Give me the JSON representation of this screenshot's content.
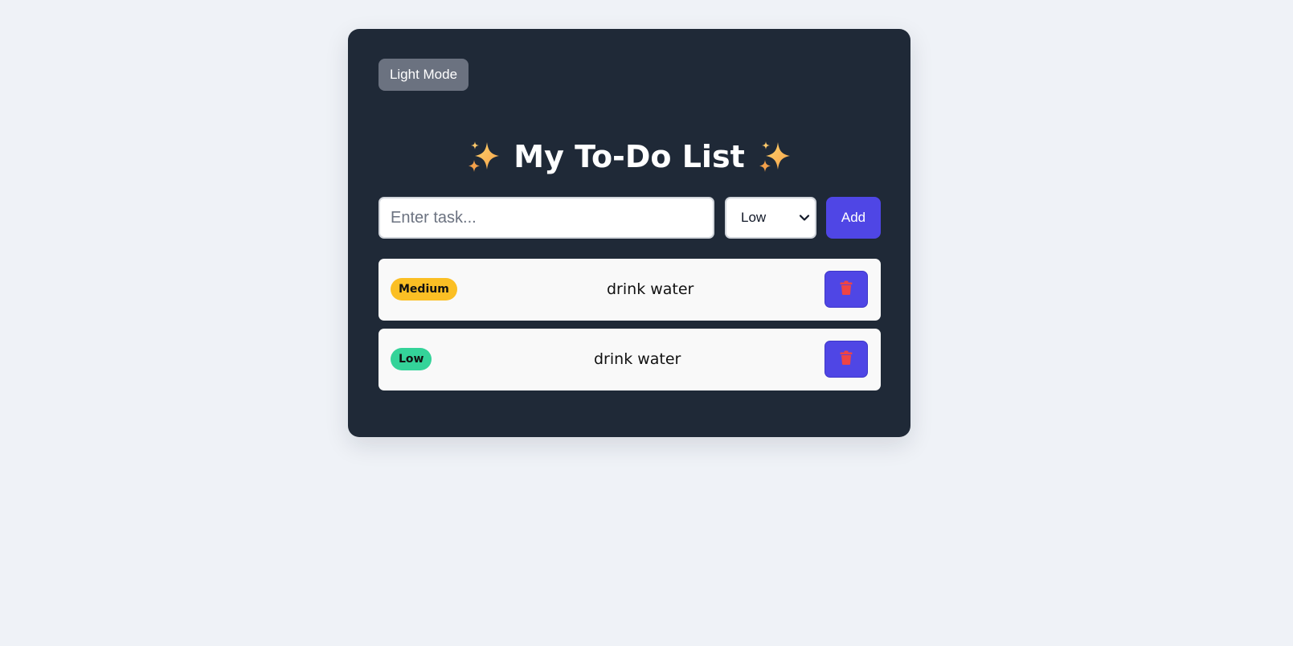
{
  "header": {
    "mode_toggle_label": "Light Mode",
    "title": "My To-Do List"
  },
  "form": {
    "task_placeholder": "Enter task...",
    "task_value": "",
    "priority_selected": "Low",
    "add_label": "Add"
  },
  "tasks": [
    {
      "priority": "Medium",
      "text": "drink water",
      "priority_color": "#fbbf24"
    },
    {
      "priority": "Low",
      "text": "drink water",
      "priority_color": "#34d399"
    }
  ],
  "icons": {
    "title_decoration": "sparkles-icon",
    "delete": "trash-icon",
    "select": "chevron-down-icon"
  },
  "colors": {
    "page_background": "#eff2f7",
    "card_background": "#1f2937",
    "accent": "#4f46e5",
    "mode_button": "#6b7280",
    "trash": "#ef4444"
  }
}
